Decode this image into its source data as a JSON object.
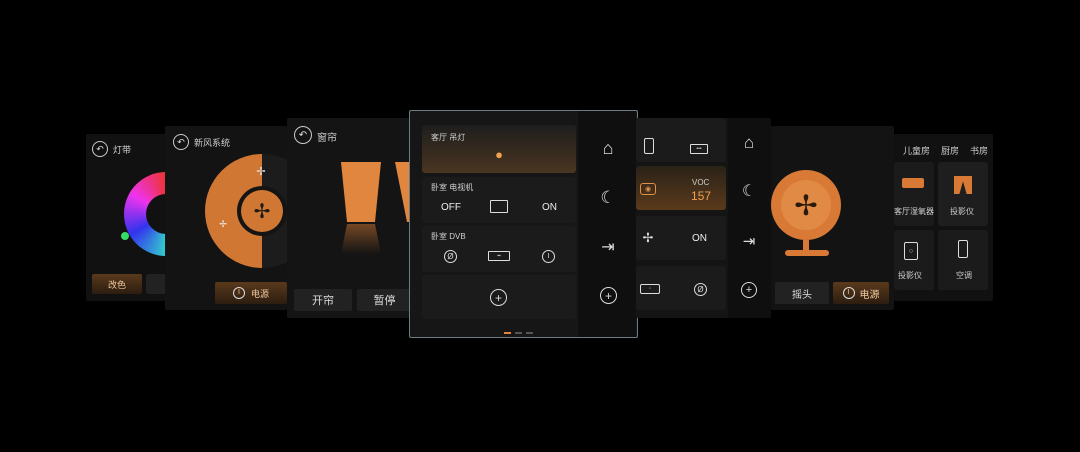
{
  "panel_light": {
    "title": "灯带",
    "btn_color": "改色"
  },
  "panel_fresh_air": {
    "title": "新风系统",
    "btn_power": "电源"
  },
  "panel_curtain": {
    "title": "窗帘",
    "btn_open": "开帘",
    "btn_pause": "暂停"
  },
  "panel_main": {
    "row1_label": "客厅 吊灯",
    "row2_label": "卧室 电视机",
    "row2_off": "OFF",
    "row2_on": "ON",
    "row3_label": "卧室 DVB"
  },
  "panel_sensor": {
    "voc_label": "VOC",
    "voc_value": "157",
    "on_label": "ON"
  },
  "panel_fan": {
    "btn_swing": "摇头",
    "btn_power": "电源"
  },
  "panel_rooms": {
    "tabs": [
      "儿童房",
      "厨房",
      "书房"
    ],
    "items": [
      "客厅湿氧器",
      "投影仪",
      "投影仪",
      "空调"
    ]
  },
  "colors": {
    "accent": "#e3803a",
    "panel_bg": "#121212",
    "button_bg": "#222222"
  }
}
